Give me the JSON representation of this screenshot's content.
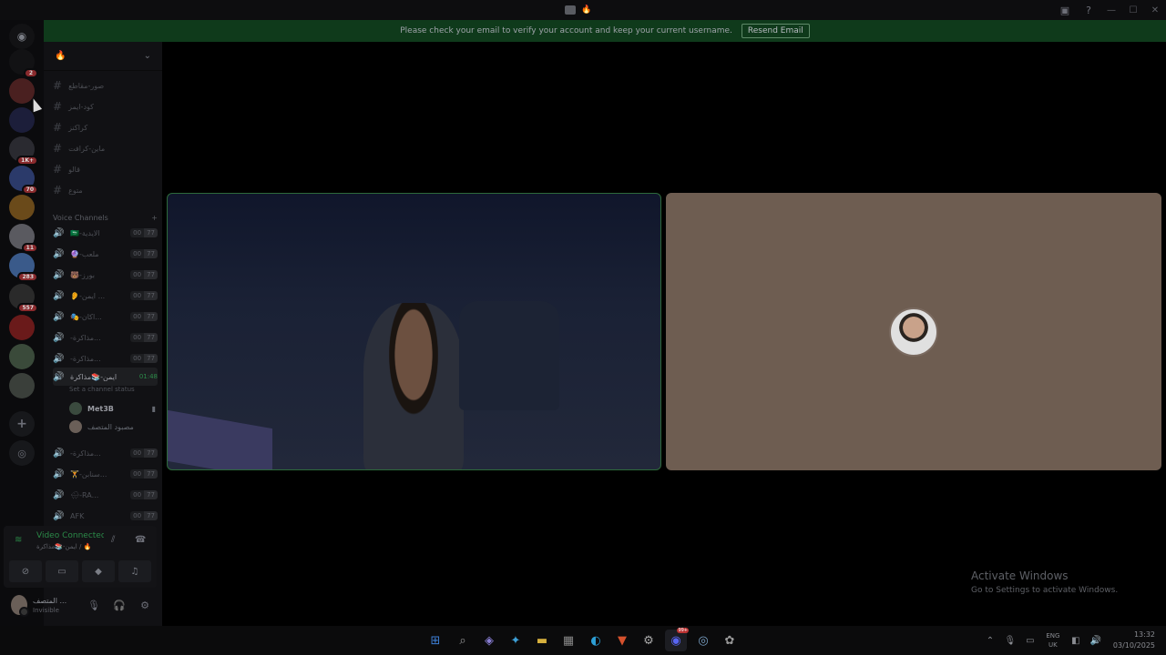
{
  "titlebar": {
    "title_icons": [
      "steam-deck-icon",
      "fire-icon"
    ]
  },
  "notice": {
    "text": "Please check your email to verify your account and keep your current username.",
    "button": "Resend Email"
  },
  "rail": {
    "servers": [
      {
        "name": "speaker-server",
        "badge": "2"
      },
      {
        "name": "triangle-server",
        "badge": ""
      },
      {
        "name": "folder-server",
        "badge": ""
      },
      {
        "name": "d-server",
        "badge": "1K+"
      },
      {
        "name": "anime-server",
        "badge": "70"
      },
      {
        "name": "warrior-server",
        "badge": ""
      },
      {
        "name": "sl-server",
        "badge": "11"
      },
      {
        "name": "blue-server",
        "badge": "283"
      },
      {
        "name": "dark-server",
        "badge": "557"
      },
      {
        "name": "red-triangle-server",
        "badge": ""
      },
      {
        "name": "group-server",
        "badge": ""
      },
      {
        "name": "group2-server",
        "badge": ""
      }
    ]
  },
  "guild": {
    "name": "🔥"
  },
  "text_channels": [
    "صور-مقاطع",
    "كود-ايمز",
    "كراكنز",
    "ماين-كرافت",
    "قالو",
    "متوع"
  ],
  "voice_header": "Voice Channels",
  "voice_channels": [
    {
      "name": "🇸🇦-الايدية",
      "a": "00",
      "b": "77"
    },
    {
      "name": "🔮-ملعب",
      "a": "00",
      "b": "77"
    },
    {
      "name": "🐻-بورز",
      "a": "00",
      "b": "77"
    },
    {
      "name": "👂-ايمن ...",
      "a": "00",
      "b": "77"
    },
    {
      "name": "🎭-اكان...",
      "a": "00",
      "b": "77"
    },
    {
      "name": "-مذاكرة...",
      "a": "00",
      "b": "77"
    },
    {
      "name": "-مذاكرة...",
      "a": "00",
      "b": "77"
    }
  ],
  "active_channel": {
    "name": "ايمن-📚مذاكرة",
    "time": "01:48",
    "status": "Set a channel status"
  },
  "voice_users": [
    {
      "name": "Met3B"
    },
    {
      "name": "مصبود المتصف"
    }
  ],
  "voice_channels_after": [
    {
      "name": "-مذاكرة...",
      "a": "00",
      "b": "77"
    },
    {
      "name": "🏋-سنابن...",
      "a": "00",
      "b": "77"
    },
    {
      "name": "🌧-RA...",
      "a": "00",
      "b": "77"
    },
    {
      "name": "AFK",
      "a": "00",
      "b": "77"
    }
  ],
  "voice_panel": {
    "status": "Video Connected",
    "sub": "ايمن-📚مذاكرة / 🔥"
  },
  "user": {
    "name": "المتصف ...",
    "status": "Invisible"
  },
  "activate": {
    "title": "Activate Windows",
    "sub": "Go to Settings to activate Windows."
  },
  "tray": {
    "lang1": "ENG",
    "lang2": "UK",
    "time": "13:32",
    "date": "03/10/2025"
  },
  "taskbar_badge": "99+"
}
